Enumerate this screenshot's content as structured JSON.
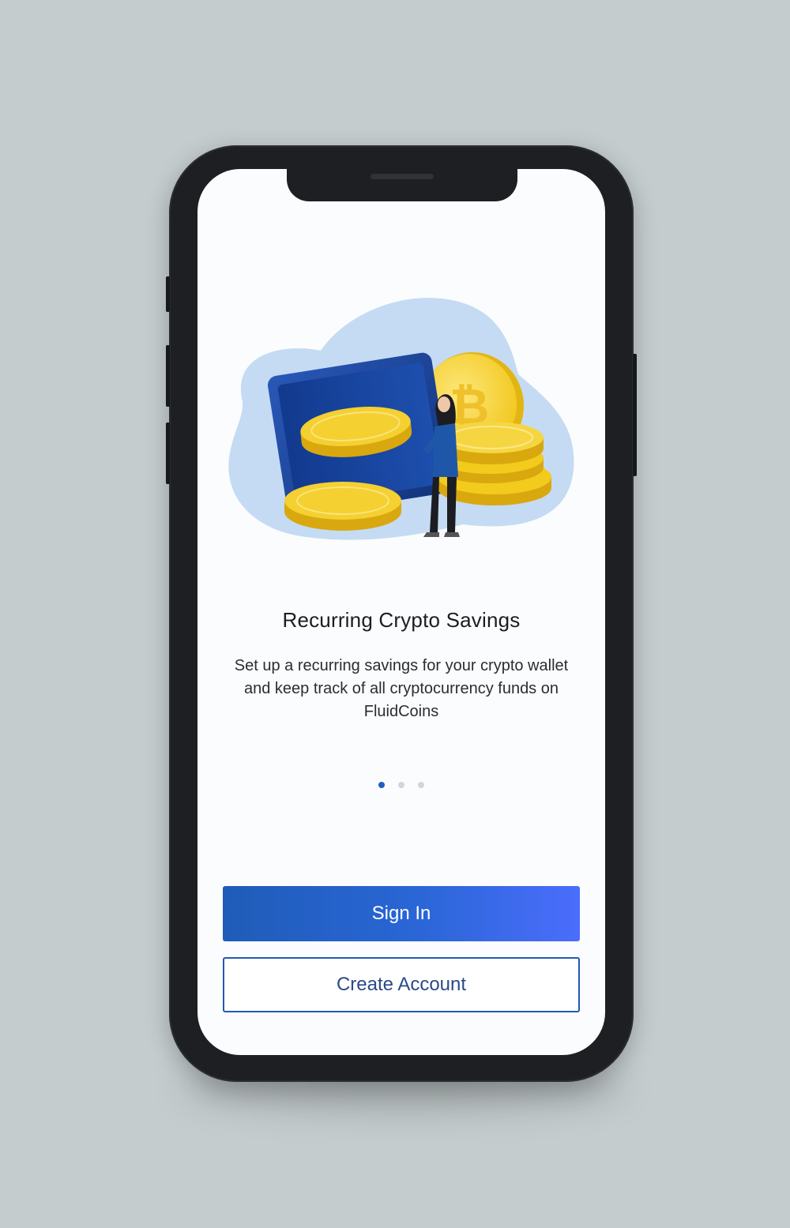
{
  "onboarding": {
    "headline": "Recurring Crypto Savings",
    "description": "Set up a recurring savings for your crypto wallet and keep track of all cryptocurrency funds on FluidCoins",
    "pagination": {
      "current": 1,
      "total": 3
    }
  },
  "actions": {
    "sign_in_label": "Sign In",
    "create_account_label": "Create Account"
  },
  "colors": {
    "background": "#c4cccd",
    "phone_body": "#1d1f22",
    "screen": "#fbfcfd",
    "primary_start": "#1f5cb8",
    "primary_end": "#4b6dfd",
    "outline_border": "#2158b6",
    "coin": "#f2cb1d",
    "wallet": "#1a3f93",
    "blob": "#c4dbf3",
    "dot_active": "#1e5fbf",
    "dot_inactive": "#cfd6de"
  },
  "icons": {
    "illustration": "wallet-with-bitcoin-coins-illustration",
    "coin": "bitcoin-icon"
  }
}
